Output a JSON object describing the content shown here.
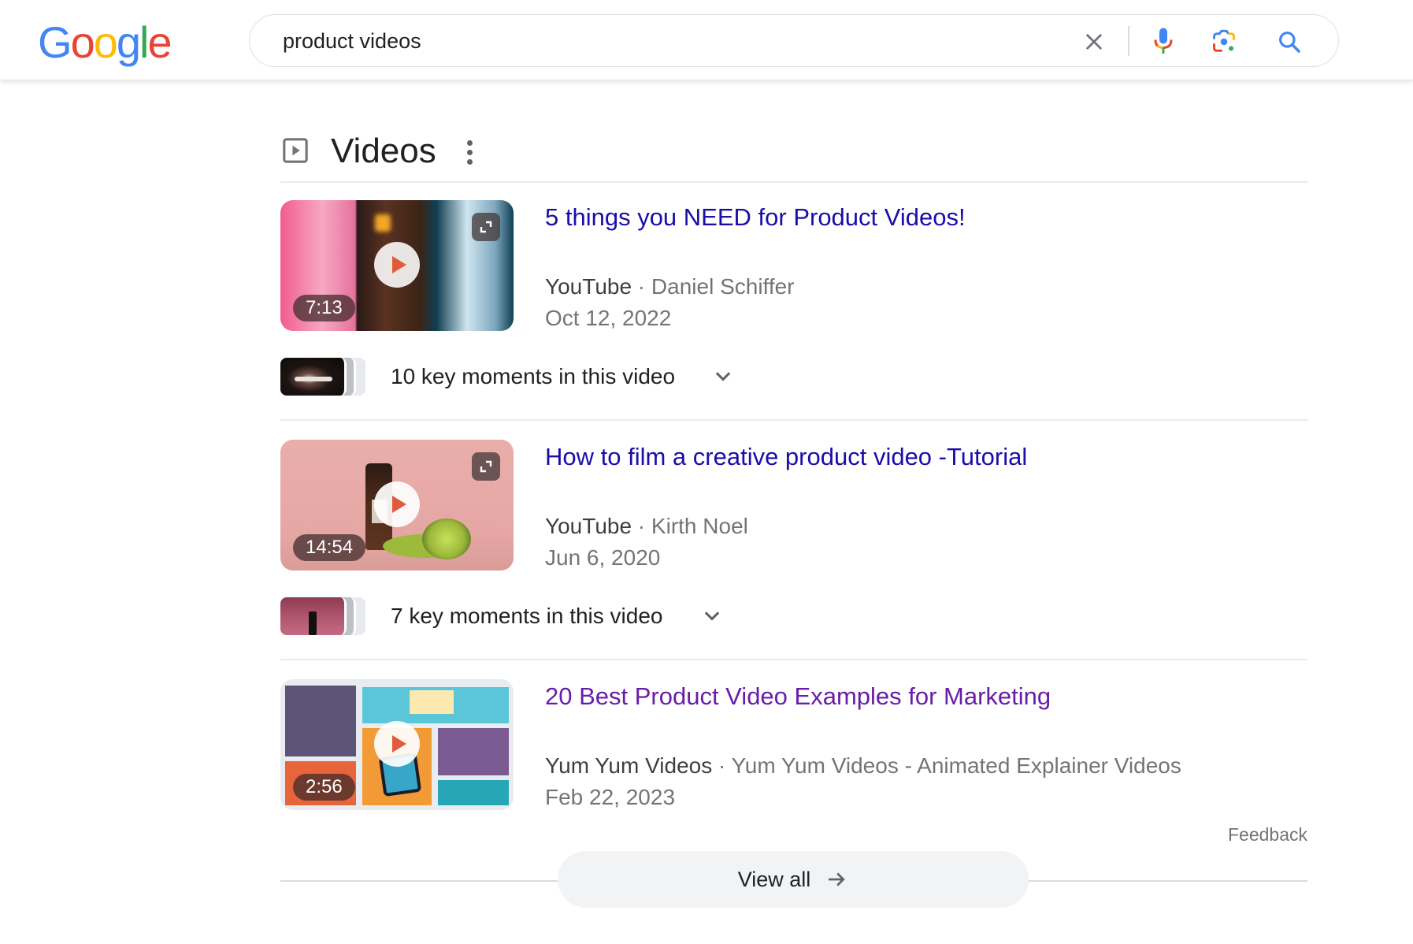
{
  "header": {
    "logo": {
      "letters": [
        {
          "char": "G",
          "color": "#4285F4"
        },
        {
          "char": "o",
          "color": "#EA4335"
        },
        {
          "char": "o",
          "color": "#FBBC05"
        },
        {
          "char": "g",
          "color": "#4285F4"
        },
        {
          "char": "l",
          "color": "#34A853"
        },
        {
          "char": "e",
          "color": "#EA4335"
        }
      ]
    },
    "search": {
      "value": "product videos",
      "icons": [
        "close-icon",
        "microphone-icon",
        "google-lens-icon",
        "search-icon"
      ]
    }
  },
  "videos_section": {
    "title": "Videos",
    "icon": "video-play-icon",
    "results": [
      {
        "title": "5 things you NEED for Product Videos!",
        "visited": false,
        "source": "YouTube",
        "separator": " · ",
        "channel": "Daniel Schiffer",
        "date": "Oct 12, 2022",
        "duration": "7:13",
        "key_moments": "10 key moments in this video"
      },
      {
        "title": "How to film a creative product video -Tutorial",
        "visited": false,
        "source": "YouTube",
        "separator": " · ",
        "channel": "Kirth Noel",
        "date": "Jun 6, 2020",
        "duration": "14:54",
        "key_moments": "7 key moments in this video"
      },
      {
        "title": "20 Best Product Video Examples for Marketing",
        "visited": true,
        "source": "Yum Yum Videos",
        "separator": " · ",
        "channel": "Yum Yum Videos - Animated Explainer Videos",
        "date": "Feb 22, 2023",
        "duration": "2:56"
      }
    ],
    "feedback_label": "Feedback",
    "view_all_label": "View all"
  },
  "colors": {
    "link_unvisited": "#1a0dab",
    "link_visited": "#681da8",
    "secondary_text": "#70757a"
  }
}
